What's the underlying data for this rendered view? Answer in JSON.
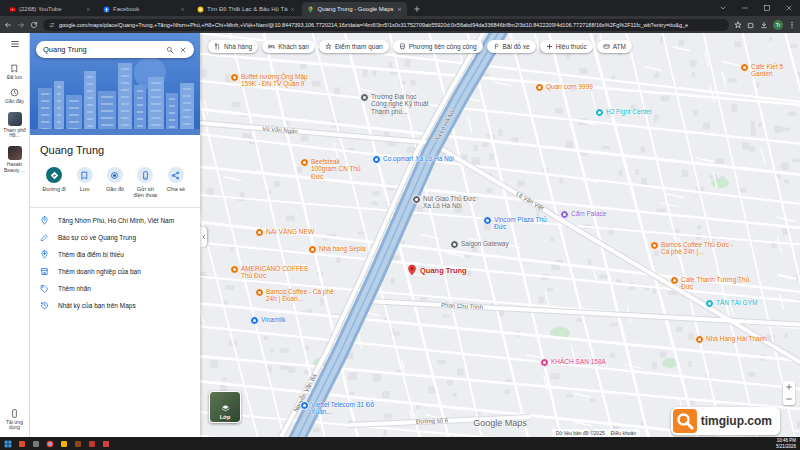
{
  "browser": {
    "tabs": [
      {
        "label": "(2268) YouTube",
        "selected": false,
        "kind": "youtube"
      },
      {
        "label": "Facebook",
        "selected": false,
        "kind": "facebook"
      },
      {
        "label": "Tìm Đồ Thất Lạc & Bảo Hộ Tà",
        "selected": false,
        "kind": "site"
      },
      {
        "label": "Quang Trung - Google Maps",
        "selected": true,
        "kind": "maps"
      }
    ],
    "url": "google.com/maps/place/Quang+Trung,+Tăng+Nhơn+Phú,+Hồ+Chí+Minh,+Việt+Nam/@10.8447393,106.7720214,16z/data=!4m6!3m5!1s0x31752709ab55920d:0x56abd94da336846b!8m2!3d10.8422209!4d106.7727188!16s%2Fg%2F11fc_wb?entry=ttu&g_e",
    "profile": "Tr"
  },
  "rail": {
    "items": [
      {
        "label": "Đã lưu",
        "kind": "saved"
      },
      {
        "label": "Gần đây",
        "kind": "recent"
      },
      {
        "label": "Tham phố Hồ...",
        "kind": "thumb"
      },
      {
        "label": "Hasaki Beauty ...",
        "kind": "thumb"
      }
    ],
    "app": "Tải ứng dụng"
  },
  "search": {
    "value": "Quang Trung"
  },
  "place": {
    "title": "Quang Trung",
    "actions": [
      {
        "label": "Đường đi",
        "primary": true,
        "kind": "directions"
      },
      {
        "label": "Lưu",
        "primary": false,
        "kind": "save"
      },
      {
        "label": "Gần đó",
        "primary": false,
        "kind": "nearby"
      },
      {
        "label": "Gửi tới điện thoại",
        "primary": false,
        "kind": "phone"
      },
      {
        "label": "Chia sẻ",
        "primary": false,
        "kind": "share"
      }
    ],
    "details": [
      {
        "label": "Tăng Nhơn Phú, Hồ Chí Minh, Việt Nam",
        "kind": "address"
      },
      {
        "label": "Báo sự cố về Quang Trung",
        "kind": "edit"
      },
      {
        "label": "Thêm địa điểm bị thiếu",
        "kind": "add-place"
      },
      {
        "label": "Thêm doanh nghiệp của bạn",
        "kind": "business"
      },
      {
        "label": "Thêm nhãn",
        "kind": "label"
      },
      {
        "label": "Nhật ký của bạn trên Maps",
        "kind": "history"
      }
    ]
  },
  "chips": [
    {
      "label": "Nhà hàng",
      "kind": "restaurant"
    },
    {
      "label": "Khách sạn",
      "kind": "hotel"
    },
    {
      "label": "Điểm tham quan",
      "kind": "attraction"
    },
    {
      "label": "Phương tiện công cộng",
      "kind": "transit"
    },
    {
      "label": "Bãi đỗ xe",
      "kind": "parking"
    },
    {
      "label": "Hiệu thuốc",
      "kind": "pharmacy"
    },
    {
      "label": "ATM",
      "kind": "atm"
    }
  ],
  "map": {
    "pin": {
      "label": "Quang Trung"
    },
    "pois": [
      {
        "label": "Buffet nướng Ông Mập 159K - ĐN TV Quận 9",
        "color": "#e8710a"
      },
      {
        "label": "Trường Đại học Công nghệ Kỹ thuật Thành phố...",
        "color": "#5f6368"
      },
      {
        "label": "Quán cơm 9999",
        "color": "#e8710a"
      },
      {
        "label": "H2 Fight Center",
        "color": "#12b5cb"
      },
      {
        "label": "Cafe Kiết 5 Garden",
        "color": "#e8710a"
      },
      {
        "label": "Co.opmart Xa Lộ Hà Nội",
        "color": "#1a73e8"
      },
      {
        "label": "Beefsteak 100gram CN Thủ Đức",
        "color": "#e8710a"
      },
      {
        "label": "Nút Giao Thủ Đức Xa Lộ Hà Nội",
        "color": "#5f6368"
      },
      {
        "label": "Vincom Plaza Thủ Đức",
        "color": "#1a73e8"
      },
      {
        "label": "Cẩm Palace",
        "color": "#8e63ce"
      },
      {
        "label": "Saigon Gateway",
        "color": "#5f6368"
      },
      {
        "label": "NAI VÀNG NEW",
        "color": "#e8710a"
      },
      {
        "label": "Nhà hàng Sepia",
        "color": "#e8710a"
      },
      {
        "label": "AMERICANO COFFEE Thủ Đức",
        "color": "#e8710a"
      },
      {
        "label": "Bamos Coffee - Cà phê 24h | Đoàn...",
        "color": "#e8710a"
      },
      {
        "label": "Bamos Coffee Thủ Đức - Cà phê 24h |...",
        "color": "#e8710a"
      },
      {
        "label": "Cafe Thanh Tường Thủ Đức",
        "color": "#e8710a"
      },
      {
        "label": "TÂN TÀI GYM",
        "color": "#12b5cb"
      },
      {
        "label": "Nhà Hàng Hải Thành",
        "color": "#e8710a"
      },
      {
        "label": "KHÁCH SẠN 158A",
        "color": "#d93f8e"
      },
      {
        "label": "Vinamilk",
        "color": "#1a73e8"
      },
      {
        "label": "Viettel Telecom 31 Đỗ Xuân...",
        "color": "#1a73e8"
      }
    ],
    "roads": [
      {
        "label": "Xa Lộ Hà Nội"
      },
      {
        "label": "Lê Văn Việt"
      },
      {
        "label": "Võ Văn Ngân"
      },
      {
        "label": "Phan Chu Trinh"
      },
      {
        "label": "Nguyễn Văn Bá"
      },
      {
        "label": "Đường số 6"
      }
    ],
    "layers": "Lớp",
    "logo": "Google Maps",
    "footer": [
      "Dữ liệu bản đồ ©2025",
      "Điều khoản"
    ]
  },
  "watermark": "timgiup.com",
  "taskbar": {
    "time": "10:46 PM",
    "date": "5/21/2026"
  }
}
